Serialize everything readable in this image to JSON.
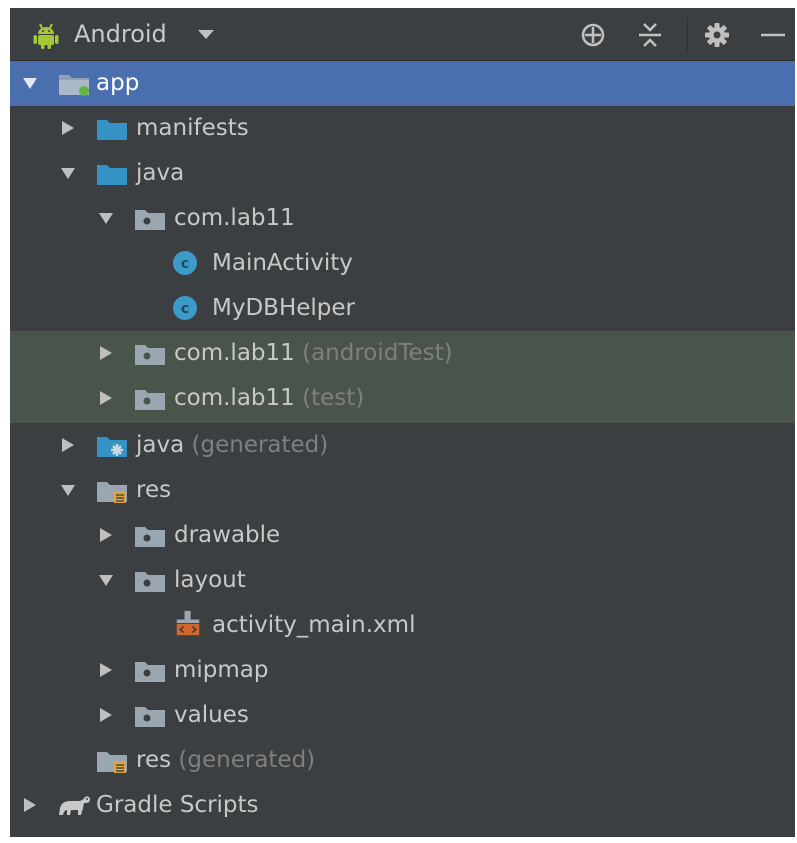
{
  "toolbar": {
    "view_mode": "Android",
    "android_icon": "android-icon",
    "locate_icon": "locate-icon",
    "collapse_icon": "collapse-all-icon",
    "settings_icon": "gear-icon",
    "hide_icon": "minimize-icon"
  },
  "tree": {
    "app": "app",
    "manifests": "manifests",
    "java": "java",
    "pkg_main": "com.lab11",
    "main_activity": "MainActivity",
    "db_helper": "MyDBHelper",
    "pkg_android_test": "com.lab11",
    "pkg_android_test_suffix": "(androidTest)",
    "pkg_test": "com.lab11",
    "pkg_test_suffix": "(test)",
    "java_generated": "java",
    "java_generated_suffix": "(generated)",
    "res": "res",
    "drawable": "drawable",
    "layout": "layout",
    "activity_main": "activity_main.xml",
    "mipmap": "mipmap",
    "values": "values",
    "res_generated": "res",
    "res_generated_suffix": "(generated)",
    "gradle_scripts": "Gradle Scripts"
  },
  "colors": {
    "panel_bg": "#3c3f41",
    "selection": "#4b6eaf",
    "test_source_bg": "#49544a",
    "folder_blue": "#3592c4",
    "class_icon": "#3d9bc9",
    "android_green": "#a4c639",
    "xml_orange": "#d0662c"
  }
}
